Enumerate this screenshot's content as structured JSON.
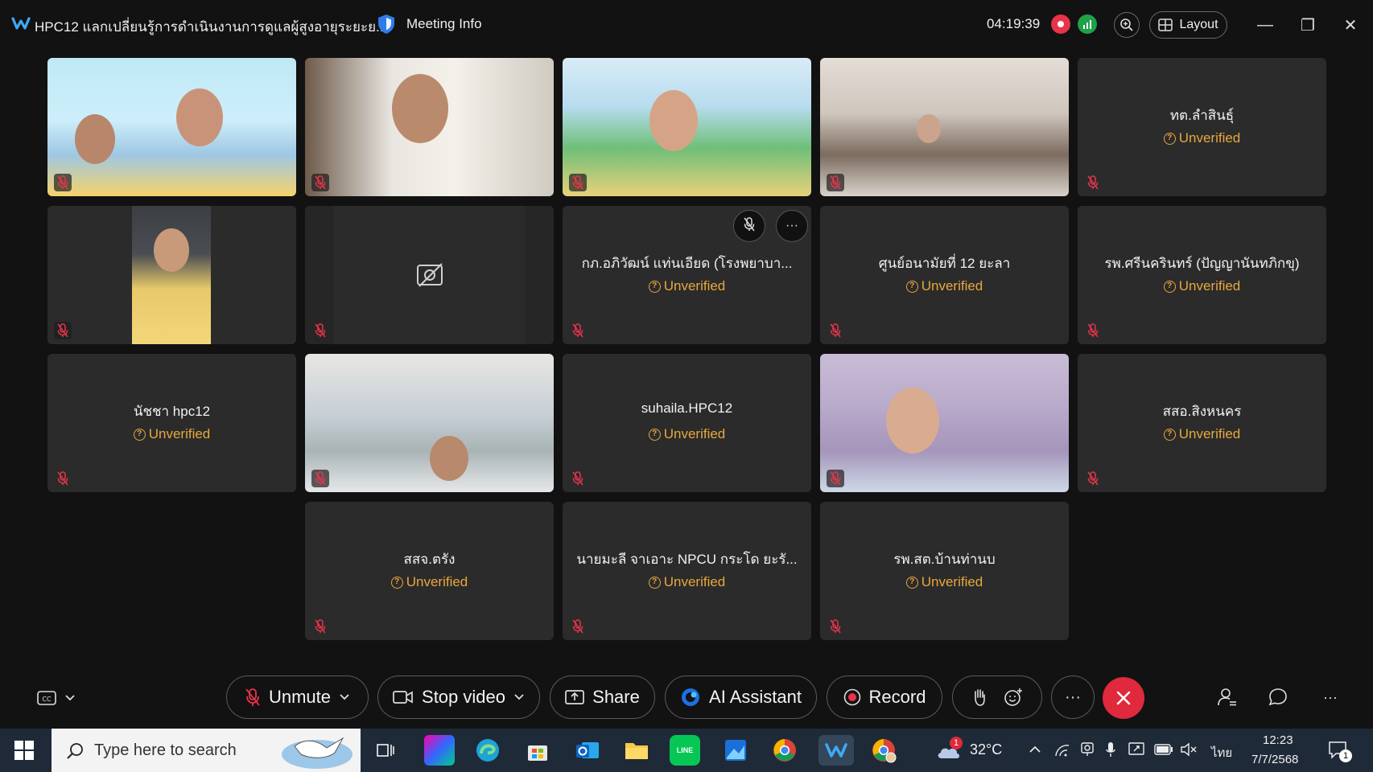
{
  "window": {
    "title": "HPC12 แลกเปลี่ยนรู้การดำเนินงานการดูแลผู้สูงอายุระยะย...",
    "meeting_info": "Meeting Info",
    "timer": "04:19:39",
    "layout_label": "Layout",
    "minimize": "—",
    "maximize": "❐",
    "close": "✕"
  },
  "unverified_label": "Unverified",
  "tiles": [
    {
      "name": "",
      "video": true
    },
    {
      "name": "",
      "video": true
    },
    {
      "name": "",
      "video": true
    },
    {
      "name": "",
      "video": true
    },
    {
      "name": "ทต.ลำสินธุ์",
      "video": false
    },
    {
      "name": "",
      "video": true
    },
    {
      "name": "",
      "video": false,
      "camera_off": true
    },
    {
      "name": "กภ.อภิวัฒน์ แท่นเอียด (โรงพยาบา...",
      "video": false
    },
    {
      "name": "ศูนย์อนามัยที่ 12 ยะลา",
      "video": false
    },
    {
      "name": "รพ.ศรีนครินทร์ (ปัญญานันทภิกขุ)",
      "video": false
    },
    {
      "name": "นัชชา hpc12",
      "video": false
    },
    {
      "name": "",
      "video": true
    },
    {
      "name": "suhaila.HPC12",
      "video": false
    },
    {
      "name": "",
      "video": true
    },
    {
      "name": "สสอ.สิงหนคร",
      "video": false
    },
    {
      "name": "สสจ.ตรัง",
      "video": false
    },
    {
      "name": "นายมะลี จาเอาะ NPCU กระโด ยะรั...",
      "video": false
    },
    {
      "name": "รพ.สต.บ้านท่านบ",
      "video": false
    }
  ],
  "toolbar": {
    "unmute": "Unmute",
    "stop_video": "Stop video",
    "share": "Share",
    "ai_assistant": "AI Assistant",
    "record": "Record",
    "more": "···"
  },
  "taskbar": {
    "search_placeholder": "Type here to search",
    "weather": "32°C",
    "weather_badge": "1",
    "language": "ไทย",
    "time": "12:23",
    "date": "7/7/2568",
    "notification_count": "1"
  },
  "colors": {
    "background": "#121212",
    "tile": "#2b2b2b",
    "unverified": "#e9a73c",
    "end_call": "#e0293d",
    "taskbar": "#1f2a38"
  }
}
